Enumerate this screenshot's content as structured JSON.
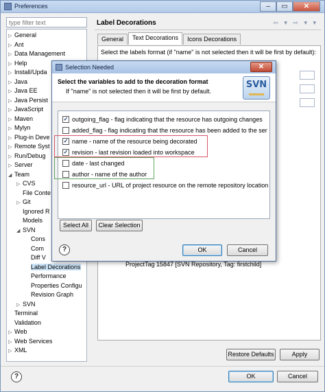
{
  "window": {
    "title": "Preferences",
    "min_glyph": "–",
    "max_glyph": "▭",
    "close_glyph": "✕"
  },
  "filter": {
    "placeholder": "type filter text"
  },
  "tree": [
    {
      "label": "General",
      "indent": 0,
      "arrow": "▷"
    },
    {
      "label": "Ant",
      "indent": 0,
      "arrow": "▷"
    },
    {
      "label": "Data Management",
      "indent": 0,
      "arrow": "▷"
    },
    {
      "label": "Help",
      "indent": 0,
      "arrow": "▷"
    },
    {
      "label": "Install/Upda",
      "indent": 0,
      "arrow": "▷"
    },
    {
      "label": "Java",
      "indent": 0,
      "arrow": "▷"
    },
    {
      "label": "Java EE",
      "indent": 0,
      "arrow": "▷"
    },
    {
      "label": "Java Persist",
      "indent": 0,
      "arrow": "▷"
    },
    {
      "label": "JavaScript",
      "indent": 0,
      "arrow": "▷"
    },
    {
      "label": "Maven",
      "indent": 0,
      "arrow": "▷"
    },
    {
      "label": "Mylyn",
      "indent": 0,
      "arrow": "▷"
    },
    {
      "label": "Plug-in Deve",
      "indent": 0,
      "arrow": "▷"
    },
    {
      "label": "Remote Syst",
      "indent": 0,
      "arrow": "▷"
    },
    {
      "label": "Run/Debug",
      "indent": 0,
      "arrow": "▷"
    },
    {
      "label": "Server",
      "indent": 0,
      "arrow": "▷"
    },
    {
      "label": "Team",
      "indent": 0,
      "arrow": "◢"
    },
    {
      "label": "CVS",
      "indent": 1,
      "arrow": "▷"
    },
    {
      "label": "File Conte",
      "indent": 1,
      "arrow": ""
    },
    {
      "label": "Git",
      "indent": 1,
      "arrow": "▷"
    },
    {
      "label": "Ignored R",
      "indent": 1,
      "arrow": ""
    },
    {
      "label": "Models",
      "indent": 1,
      "arrow": ""
    },
    {
      "label": "SVN",
      "indent": 1,
      "arrow": "◢"
    },
    {
      "label": "Cons",
      "indent": 2,
      "arrow": ""
    },
    {
      "label": "Com",
      "indent": 2,
      "arrow": ""
    },
    {
      "label": "Diff V",
      "indent": 2,
      "arrow": ""
    },
    {
      "label": "Label Decorations",
      "indent": 2,
      "arrow": "",
      "selected": true
    },
    {
      "label": "Performance",
      "indent": 2,
      "arrow": ""
    },
    {
      "label": "Properties Configu",
      "indent": 2,
      "arrow": ""
    },
    {
      "label": "Revision Graph",
      "indent": 2,
      "arrow": ""
    },
    {
      "label": "SVN",
      "indent": 1,
      "arrow": "▷"
    },
    {
      "label": "Terminal",
      "indent": 0,
      "arrow": ""
    },
    {
      "label": "Validation",
      "indent": 0,
      "arrow": ""
    },
    {
      "label": "Web",
      "indent": 0,
      "arrow": "▷"
    },
    {
      "label": "Web Services",
      "indent": 0,
      "arrow": "▷"
    },
    {
      "label": "XML",
      "indent": 0,
      "arrow": "▷"
    }
  ],
  "panel": {
    "title": "Label Decorations",
    "nav": "⇦ ▾ ⇨ ▾ ▾",
    "tabs": [
      "General",
      "Text Decorations",
      "Icons Decorations"
    ],
    "select_text": "Select the labels format (if \"name\" is not selected then it will be first by default):",
    "preview_item": "ProjectTag 15847 [SVN Repository, Tag: firstchild]",
    "restore_defaults": "Restore Defaults",
    "apply": "Apply"
  },
  "footer": {
    "help": "?",
    "ok": "OK",
    "cancel": "Cancel"
  },
  "dialog": {
    "title": "Selection Needed",
    "close_glyph": "✕",
    "heading": "Select the variables to add to the decoration format",
    "subheading": "If \"name\" is not selected then it will be first by default.",
    "logo_text": "SVN",
    "variables": [
      {
        "checked": true,
        "text": "outgoing_flag - flag indicating that the resource has outgoing changes"
      },
      {
        "checked": false,
        "text": "added_flag - flag indicating that the resource has been added to the ser"
      },
      {
        "checked": true,
        "text": "name - name of the resource being decorated"
      },
      {
        "checked": true,
        "text": "revision - last revision loaded into workspace"
      },
      {
        "checked": false,
        "text": "date - last changed"
      },
      {
        "checked": false,
        "text": "author - name of the author"
      },
      {
        "checked": false,
        "text": "resource_url - URL of project resource on the remote repository location"
      }
    ],
    "check_glyph": "✓",
    "select_all": "Select All",
    "clear_selection": "Clear Selection",
    "help": "?",
    "ok": "OK",
    "cancel": "Cancel"
  }
}
